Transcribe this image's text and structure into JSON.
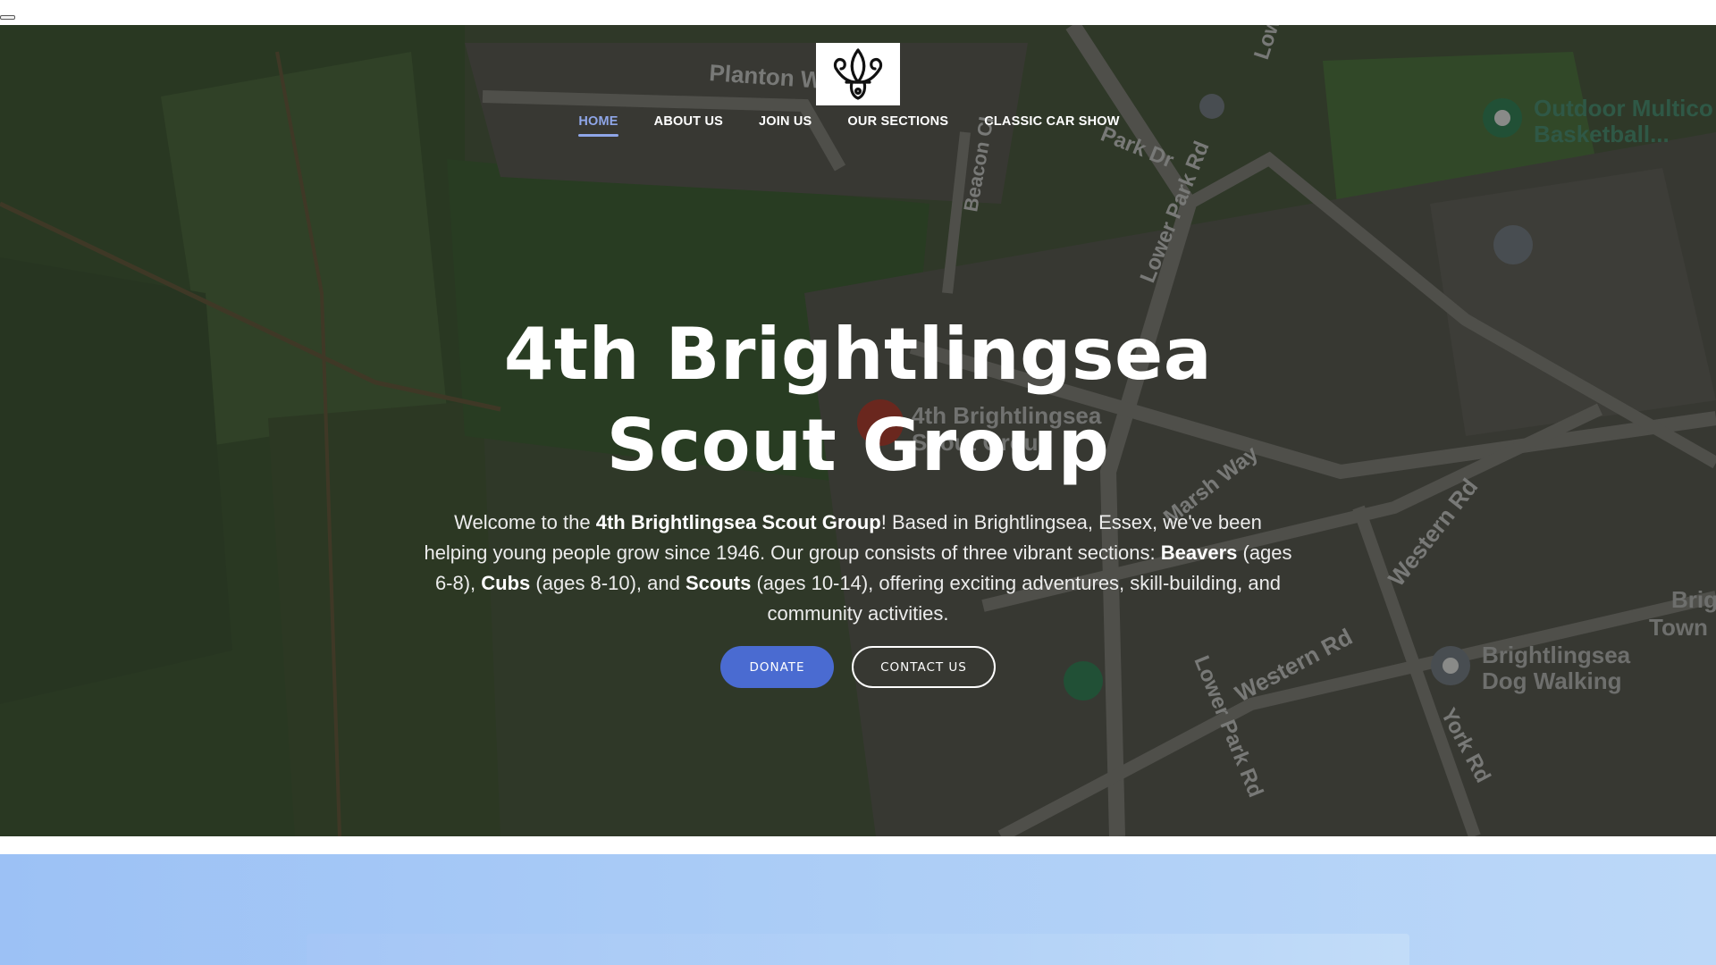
{
  "page": {
    "brand_color": "#4a6bd1",
    "active_nav_color": "#8fa6e8"
  },
  "header": {
    "logo_icon": "fleur-de-lis-icon"
  },
  "nav": {
    "items": [
      {
        "label": "HOME",
        "active": true
      },
      {
        "label": "ABOUT US",
        "active": false
      },
      {
        "label": "JOIN US",
        "active": false
      },
      {
        "label": "OUR SECTIONS",
        "active": false
      },
      {
        "label": "CLASSIC CAR SHOW",
        "active": false
      }
    ]
  },
  "hero": {
    "title_line1": "4th Brightlingsea",
    "title_line2": "Scout Group",
    "intro": {
      "p1": "Welcome to the ",
      "group_name": "4th Brightlingsea Scout Group",
      "p2": "! Based in Brightlingsea, Essex, we've been helping young people grow since 1946. Our group consists of three vibrant sections: ",
      "beavers": "Beavers",
      "p3": " (ages 6-8), ",
      "cubs": "Cubs",
      "p4": " (ages 8-10), and ",
      "scouts": "Scouts",
      "p5": " (ages 10-14), offering exciting adventures, skill-building, and community activities."
    },
    "donate_label": "DONATE",
    "contact_label": "CONTACT US"
  },
  "map_labels": {
    "planton": "Planton W",
    "park_dr": "Park Dr",
    "lower_park_rd_top": "Lower Park Rd",
    "beacon_cl": "Beacon Cl",
    "low": "Low",
    "outdoor_line1": "Outdoor Multico",
    "outdoor_line2": "Basketball...",
    "pin_label_line1": "4th Brightlingsea",
    "pin_label_line2": "Scout Group",
    "marsh_way": "Marsh Way",
    "western_rd_right": "Western Rd",
    "western_rd_bottom": "Western Rd",
    "lower_park_rd_bottom": "Lower Park Rd",
    "york_rd": "York Rd",
    "dog_walking_line1": "Brightlingsea",
    "dog_walking_line2": "Dog Walking",
    "town_line1": "Bright",
    "town_line2": "Town"
  }
}
